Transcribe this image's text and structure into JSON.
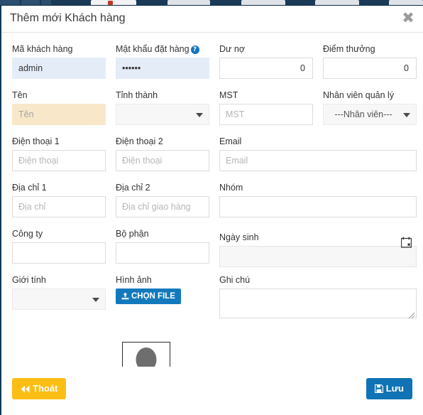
{
  "browser": {
    "strip_visible": true
  },
  "modal": {
    "title": "Thêm mới Khách hàng",
    "close_icon": "close-icon",
    "close_label": "✖"
  },
  "form": {
    "customer_code": {
      "label": "Mã khách hàng",
      "value": "admin",
      "placeholder": ""
    },
    "order_password": {
      "label": "Mật khẩu đặt hàng",
      "help_icon": "help-circle-icon",
      "help_label": "?",
      "value": "••••••",
      "placeholder": ""
    },
    "debt": {
      "label": "Dư nợ",
      "value": "0",
      "placeholder": ""
    },
    "reward_points": {
      "label": "Điểm thưởng",
      "value": "0",
      "placeholder": ""
    },
    "name": {
      "label": "Tên",
      "value": "",
      "placeholder": "Tên"
    },
    "province": {
      "label": "Tỉnh thành",
      "value": "",
      "caret_icon": "chevron-down-icon"
    },
    "tax_code": {
      "label": "MST",
      "value": "",
      "placeholder": "MST"
    },
    "manager": {
      "label": "Nhân viên quản lý",
      "value": "---Nhân viên---",
      "caret_icon": "chevron-down-icon"
    },
    "phone1": {
      "label": "Điện thoại 1",
      "value": "",
      "placeholder": "Điện thoại"
    },
    "phone2": {
      "label": "Điện thoại 2",
      "value": "",
      "placeholder": "Điện thoại"
    },
    "email": {
      "label": "Email",
      "value": "",
      "placeholder": "Email"
    },
    "address1": {
      "label": "Địa chỉ 1",
      "value": "",
      "placeholder": "Địa chỉ"
    },
    "address2": {
      "label": "Địa chỉ 2",
      "value": "",
      "placeholder": "Địa chỉ giao hàng"
    },
    "group": {
      "label": "Nhóm",
      "value": "",
      "placeholder": ""
    },
    "company": {
      "label": "Công ty",
      "value": "",
      "placeholder": ""
    },
    "department": {
      "label": "Bộ phận",
      "value": "",
      "placeholder": ""
    },
    "birthday": {
      "label": "Ngày sinh",
      "value": "",
      "placeholder": "",
      "calendar_icon": "calendar-icon"
    },
    "gender": {
      "label": "Giới tính",
      "value": "",
      "caret_icon": "chevron-down-icon"
    },
    "image": {
      "label": "Hình ảnh",
      "button_label": "CHỌN FILE",
      "button_icon": "upload-icon",
      "avatar_icon": "user-avatar-placeholder-icon"
    },
    "note": {
      "label": "Ghi chú",
      "value": "",
      "placeholder": ""
    }
  },
  "footer": {
    "exit_label": "Thoát",
    "exit_icon": "backward-double-arrow-icon",
    "save_label": "Lưu",
    "save_icon": "floppy-save-icon"
  },
  "colors": {
    "accent_blue": "#1379bd",
    "save_blue": "#0f73b5",
    "exit_yellow": "#fcbe14",
    "required_highlight": "#f8e8c9",
    "filled_field": "#e4ecf7",
    "help_blue": "#1273c4"
  }
}
